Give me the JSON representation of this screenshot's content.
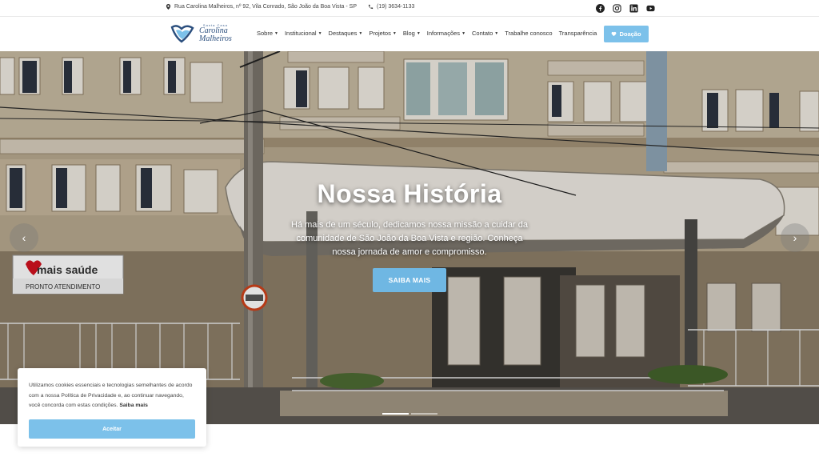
{
  "topbar": {
    "address": "Rua Carolina Malheiros, nº 92, Vila Conrado, São João da Boa Vista - SP",
    "phone": "(19) 3634-1133",
    "social": [
      "facebook-icon",
      "instagram-icon",
      "linkedin-icon",
      "youtube-icon"
    ]
  },
  "logo": {
    "small": "Santa Casa",
    "line1": "Carolina",
    "line2": "Malheiros"
  },
  "menu": {
    "items": [
      {
        "label": "Sobre",
        "dropdown": true
      },
      {
        "label": "Institucional",
        "dropdown": true
      },
      {
        "label": "Destaques",
        "dropdown": true
      },
      {
        "label": "Projetos",
        "dropdown": true
      },
      {
        "label": "Blog",
        "dropdown": true
      },
      {
        "label": "Informações",
        "dropdown": true
      },
      {
        "label": "Contato",
        "dropdown": true
      },
      {
        "label": "Trabalhe conosco",
        "dropdown": false
      },
      {
        "label": "Transparência",
        "dropdown": false
      }
    ],
    "donate": "Doação"
  },
  "hero": {
    "title": "Nossa História",
    "text": "Há mais de um século, dedicamos nossa missão a cuidar da comunidade de São João da Boa Vista e região. Conheça nossa jornada de amor e compromisso.",
    "button": "SAIBA MAIS",
    "sign_brand": "mais saúde",
    "sign_sub": "PRONTO ATENDIMENTO"
  },
  "cookie": {
    "text": "Utilizamos cookies essenciais e tecnologias semelhantes de acordo com a nossa Política de Privacidade e, ao continuar navegando, você concorda com estas condições.",
    "link": "Saiba mais",
    "accept": "Aceitar"
  },
  "colors": {
    "accent": "#7cc1ea",
    "button": "#6fb7e3"
  }
}
